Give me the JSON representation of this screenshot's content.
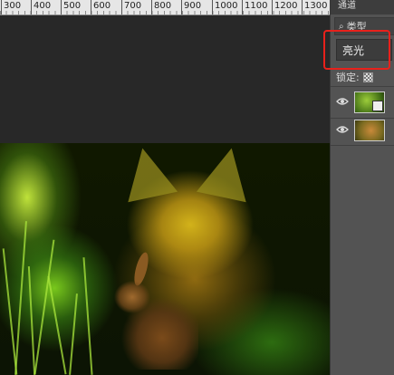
{
  "ruler": {
    "ticks": [
      "300",
      "400",
      "500",
      "600",
      "700",
      "800",
      "900",
      "1000",
      "1100",
      "1200",
      "1300"
    ]
  },
  "panel": {
    "tab_label": "通道",
    "kind_filter_label": "类型",
    "blend_mode_value": "亮光",
    "lock_label": "锁定:"
  },
  "layers": [
    {
      "eye": "visible"
    },
    {
      "eye": "visible"
    }
  ],
  "colors": {
    "highlight": "#e8211b",
    "panel_bg": "#535353"
  }
}
